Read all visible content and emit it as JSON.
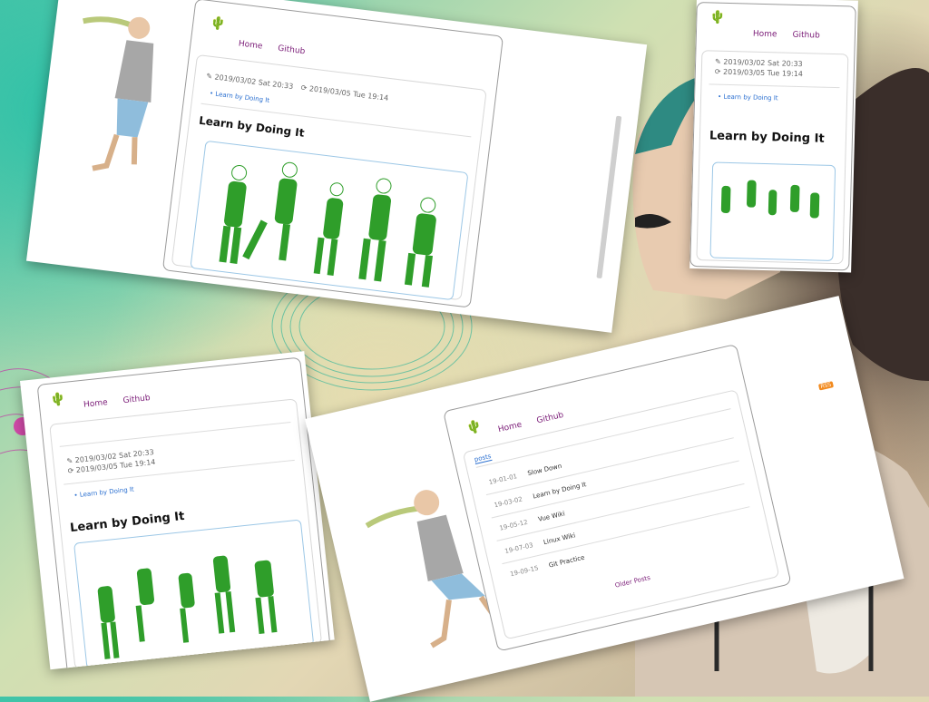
{
  "site": {
    "nav": {
      "home": "Home",
      "github": "Github"
    },
    "post": {
      "created": "2019/03/02 Sat 20:33",
      "updated": "2019/03/05 Tue 19:14",
      "link": "Learn by Doing It",
      "title": "Learn by Doing It"
    },
    "list": {
      "tab": "posts",
      "items": [
        {
          "date": "19-01-01",
          "title": "Slow Down"
        },
        {
          "date": "19-03-02",
          "title": "Learn by Doing It"
        },
        {
          "date": "19-05-12",
          "title": "Vue Wiki"
        },
        {
          "date": "19-07-03",
          "title": "Linux Wiki"
        },
        {
          "date": "19-09-15",
          "title": "Git Practice"
        }
      ],
      "pager": "Older Posts"
    },
    "badge": "RSS"
  },
  "colors": {
    "nav": "#7a1b77",
    "link": "#2a6fd0",
    "green": "#2f9e2a",
    "imgborder": "#9cc7e6"
  },
  "icons": [
    "cactus-logo-icon",
    "edit-icon",
    "refresh-icon",
    "rss-icon"
  ]
}
